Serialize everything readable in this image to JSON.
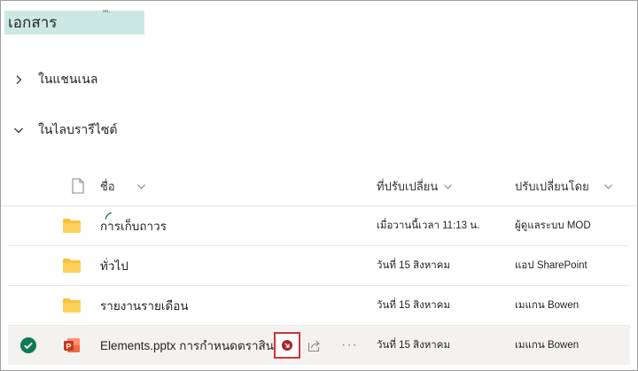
{
  "library": {
    "title": "เอกสาร",
    "tag": "ᵒᵒ·"
  },
  "groups": [
    {
      "label": "ในแชนเนล",
      "expanded": false
    },
    {
      "label": "ในไลบรารีไซต์",
      "expanded": true
    }
  ],
  "columns": {
    "name": "ชื่อ",
    "modified": "ที่ปรับเปลี่ยน",
    "modified_by": "ปรับเปลี่ยนโดย"
  },
  "rows": [
    {
      "type": "folder",
      "name": "การเก็บถาวร",
      "modified": "เมื่อวานนี้เวลา 11:13 น.",
      "modified_by": "ผู้ดูแลระบบ MOD"
    },
    {
      "type": "folder",
      "name": "ทั่วไป",
      "modified": "วันที่ 15 สิงหาคม",
      "modified_by": "แอป SharePoint"
    },
    {
      "type": "folder",
      "name": "รายงานรายเดือน",
      "modified": "วันที่ 15 สิงหาคม",
      "modified_by": "เมแกน Bowen"
    },
    {
      "type": "pptx",
      "name": "Elements.pptx การกำหนดตราสินค้า",
      "modified": "วันที่ 15 สิงหาคม",
      "modified_by": "เมแกน Bowen",
      "selected": true
    }
  ],
  "colors": {
    "folder": "#f8c13a",
    "accent": "#0f7a53",
    "ppt": "#c43e1c",
    "highlight": "#d13438",
    "title_bg": "#cbe9e2"
  }
}
